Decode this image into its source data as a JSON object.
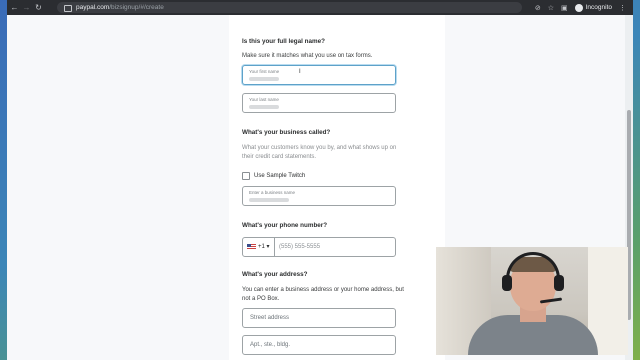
{
  "browser": {
    "url_domain": "paypal.com",
    "url_path": "/bizsignup/#/create",
    "profile_label": "Incognito",
    "icons": [
      "back-arrow-icon",
      "forward-arrow-icon",
      "reload-icon",
      "lock-icon",
      "eye-off-icon",
      "star-icon",
      "sidebar-icon",
      "profile-icon",
      "kebab-menu-icon"
    ]
  },
  "form": {
    "legal_name": {
      "question": "Is this your full legal name?",
      "helper": "Make sure it matches what you use on tax forms.",
      "first_name_label": "Your first name",
      "last_name_label": "Your last name"
    },
    "business": {
      "question": "What's your business called?",
      "helper": "What your customers know you by, and what shows up on their credit card statements.",
      "checkbox_label": "Use Sample Twitch",
      "checkbox_checked": false,
      "name_label": "Enter a business name"
    },
    "phone": {
      "question": "What's your phone number?",
      "country_code": "+1",
      "placeholder": "(555) 555-5555"
    },
    "address": {
      "question": "What's your address?",
      "helper": "You can enter a business address or your home address, but not a PO Box.",
      "street_placeholder": "Street address",
      "apt_placeholder": "Apt., ste., bldg."
    }
  }
}
